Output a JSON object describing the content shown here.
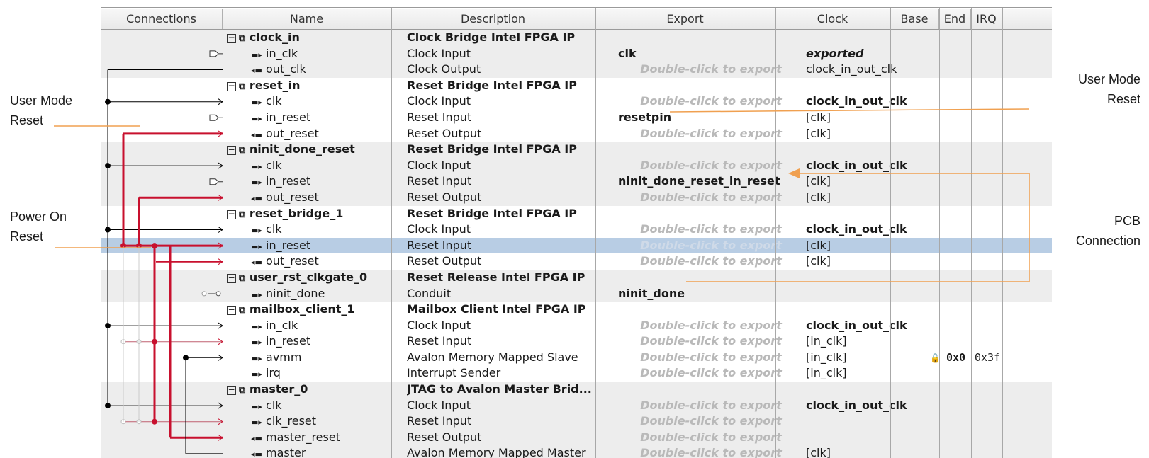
{
  "headers": [
    "Connections",
    "Name",
    "Description",
    "Export",
    "Clock",
    "Base",
    "End",
    "IRQ"
  ],
  "rows": [
    {
      "type": "group",
      "name": "clock_in",
      "desc": "Clock Bridge Intel FPGA IP",
      "export": "",
      "clock": ""
    },
    {
      "type": "port",
      "dir": "in",
      "name": "in_clk",
      "desc": "Clock Input",
      "export": "clk",
      "export_hint": false,
      "clock": "exported",
      "clock_style": "ital"
    },
    {
      "type": "port",
      "dir": "out",
      "name": "out_clk",
      "desc": "Clock Output",
      "export": "Double-click to export",
      "export_hint": true,
      "clock": "clock_in_out_clk"
    },
    {
      "type": "group",
      "name": "reset_in",
      "desc": "Reset Bridge Intel FPGA IP",
      "export": "",
      "clock": ""
    },
    {
      "type": "port",
      "dir": "in",
      "name": "clk",
      "desc": "Clock Input",
      "export": "Double-click to export",
      "export_hint": true,
      "clock": "clock_in_out_clk",
      "clock_style": "bold"
    },
    {
      "type": "port",
      "dir": "in",
      "name": "in_reset",
      "desc": "Reset Input",
      "export": "resetpin",
      "export_hint": false,
      "clock": "[clk]"
    },
    {
      "type": "port",
      "dir": "out",
      "name": "out_reset",
      "desc": "Reset Output",
      "export": "Double-click to export",
      "export_hint": true,
      "clock": "[clk]"
    },
    {
      "type": "group",
      "name": "ninit_done_reset",
      "desc": "Reset Bridge Intel FPGA IP",
      "export": "",
      "clock": ""
    },
    {
      "type": "port",
      "dir": "in",
      "name": "clk",
      "desc": "Clock Input",
      "export": "Double-click to export",
      "export_hint": true,
      "clock": "clock_in_out_clk",
      "clock_style": "bold"
    },
    {
      "type": "port",
      "dir": "in",
      "name": "in_reset",
      "desc": "Reset Input",
      "export": "ninit_done_reset_in_reset",
      "export_hint": false,
      "clock": "[clk]"
    },
    {
      "type": "port",
      "dir": "out",
      "name": "out_reset",
      "desc": "Reset Output",
      "export": "Double-click to export",
      "export_hint": true,
      "clock": "[clk]"
    },
    {
      "type": "group",
      "name": "reset_bridge_1",
      "desc": "Reset Bridge Intel FPGA IP",
      "export": "",
      "clock": ""
    },
    {
      "type": "port",
      "dir": "in",
      "name": "clk",
      "desc": "Clock Input",
      "export": "Double-click to export",
      "export_hint": true,
      "clock": "clock_in_out_clk",
      "clock_style": "bold"
    },
    {
      "type": "port",
      "dir": "in",
      "name": "in_reset",
      "desc": "Reset Input",
      "export": "Double-click to export",
      "export_hint": true,
      "clock": "[clk]",
      "selected": true
    },
    {
      "type": "port",
      "dir": "out",
      "name": "out_reset",
      "desc": "Reset Output",
      "export": "Double-click to export",
      "export_hint": true,
      "clock": "[clk]"
    },
    {
      "type": "group",
      "name": "user_rst_clkgate_0",
      "desc": "Reset Release Intel FPGA IP",
      "export": "",
      "clock": ""
    },
    {
      "type": "port",
      "dir": "in",
      "name": "ninit_done",
      "desc": "Conduit",
      "export": "ninit_done",
      "export_hint": false,
      "clock": ""
    },
    {
      "type": "group",
      "name": "mailbox_client_1",
      "desc": "Mailbox Client Intel FPGA IP",
      "export": "",
      "clock": ""
    },
    {
      "type": "port",
      "dir": "in",
      "name": "in_clk",
      "desc": "Clock Input",
      "export": "Double-click to export",
      "export_hint": true,
      "clock": "clock_in_out_clk",
      "clock_style": "bold"
    },
    {
      "type": "port",
      "dir": "in",
      "name": "in_reset",
      "desc": "Reset Input",
      "export": "Double-click to export",
      "export_hint": true,
      "clock": "[in_clk]"
    },
    {
      "type": "port",
      "dir": "in",
      "name": "avmm",
      "desc": "Avalon Memory Mapped Slave",
      "export": "Double-click to export",
      "export_hint": true,
      "clock": "[in_clk]",
      "base": "0x0",
      "end": "0x3f"
    },
    {
      "type": "port",
      "dir": "in",
      "name": "irq",
      "desc": "Interrupt Sender",
      "export": "Double-click to export",
      "export_hint": true,
      "clock": "[in_clk]"
    },
    {
      "type": "group",
      "name": "master_0",
      "desc": "JTAG to Avalon Master Brid...",
      "export": "",
      "clock": ""
    },
    {
      "type": "port",
      "dir": "in",
      "name": "clk",
      "desc": "Clock Input",
      "export": "Double-click to export",
      "export_hint": true,
      "clock": "clock_in_out_clk",
      "clock_style": "bold"
    },
    {
      "type": "port",
      "dir": "in",
      "name": "clk_reset",
      "desc": "Reset Input",
      "export": "Double-click to export",
      "export_hint": true,
      "clock": ""
    },
    {
      "type": "port",
      "dir": "out",
      "name": "master_reset",
      "desc": "Reset Output",
      "export": "Double-click to export",
      "export_hint": true,
      "clock": ""
    },
    {
      "type": "port",
      "dir": "out",
      "name": "master",
      "desc": "Avalon Memory Mapped Master",
      "export": "Double-click to export",
      "export_hint": true,
      "clock": "[clk]"
    }
  ],
  "callouts": {
    "user_mode_reset_left": [
      "User Mode",
      "Reset"
    ],
    "power_on_reset": [
      "Power On",
      "Reset"
    ],
    "user_mode_reset_right": [
      "User Mode",
      "Reset"
    ],
    "pcb_connection": [
      "PCB",
      "Connection"
    ]
  },
  "colors": {
    "callout_line": "#f0a050",
    "reset_wire": "#c8102e",
    "clock_wire": "#000000",
    "selected_row": "#b8cde4"
  }
}
